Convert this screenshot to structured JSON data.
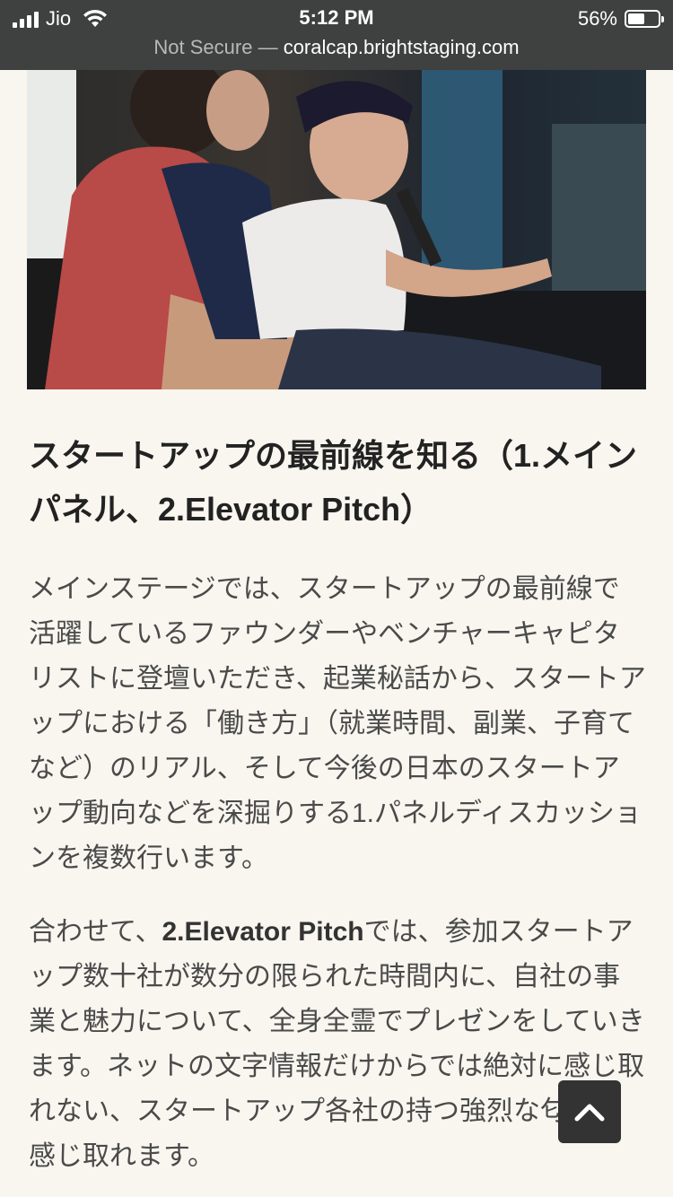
{
  "status_bar": {
    "carrier": "Jio",
    "time": "5:12 PM",
    "battery_percent": "56%",
    "battery_level": 0.56
  },
  "browser": {
    "security": "Not Secure",
    "separator": " — ",
    "url": "coralcap.brightstaging.com"
  },
  "article": {
    "hero_image": "panel-discussion-photo",
    "heading": "スタートアップの最前線を知る（1.メインパネル、2.Elevator Pitch）",
    "paragraph1": "メインステージでは、スタートアップの最前線で活躍しているファウンダーやベンチャーキャピタリストに登壇いただき、起業秘話から、スタートアップにおける「働き方」（就業時間、副業、子育てなど）のリアル、そして今後の日本のスタートアップ動向などを深掘りする1.パネルディスカッションを複数行います。",
    "paragraph2_prefix": "合わせて、",
    "paragraph2_bold": "2.Elevator Pitch",
    "paragraph2_rest": "では、参加スタートアップ数十社が数分の限られた時間内に、自社の事業と魅力について、全身全霊でプレゼンをしていきます。ネットの文字情報だけからでは絶対に感じ取れない、スタートアップ各社の持つ強烈な匂いを感じ取れます。"
  },
  "back_to_top_icon": "chevron-up-icon"
}
